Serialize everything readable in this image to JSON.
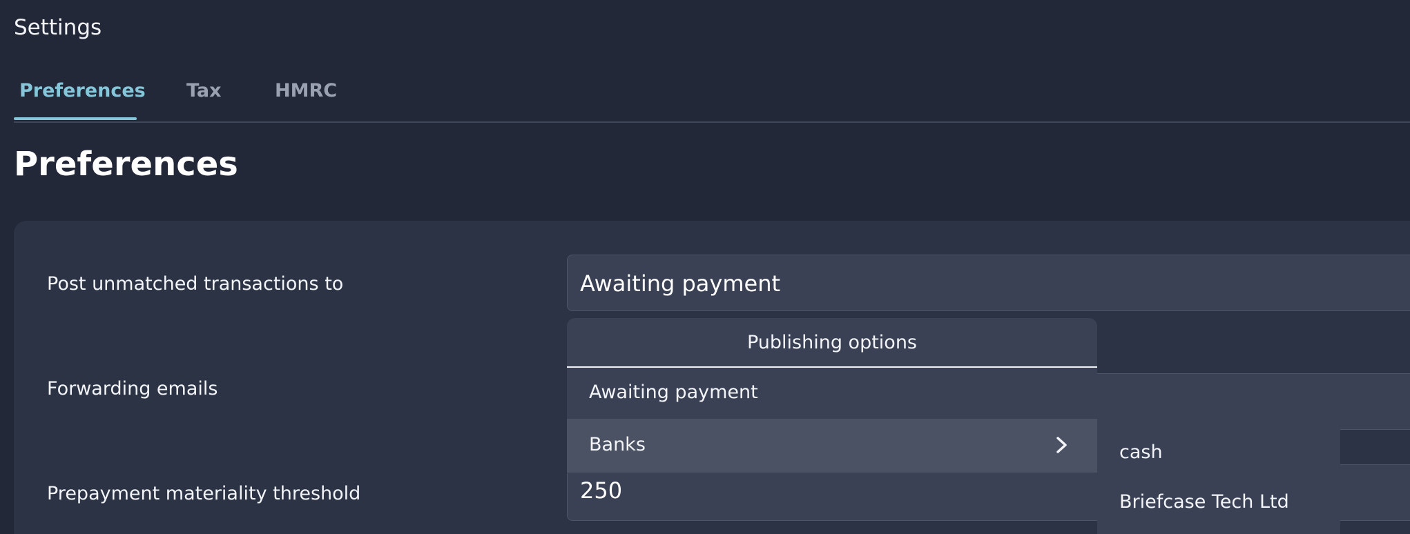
{
  "header": {
    "title": "Settings"
  },
  "tabs": [
    {
      "label": "Preferences",
      "active": true
    },
    {
      "label": "Tax",
      "active": false
    },
    {
      "label": "HMRC",
      "active": false
    }
  ],
  "section": {
    "title": "Preferences"
  },
  "rows": {
    "post_unmatched": {
      "label": "Post unmatched transactions to",
      "value": "Awaiting payment"
    },
    "forwarding": {
      "label": "Forwarding emails",
      "value": ""
    },
    "prepayment": {
      "label": "Prepayment materiality threshold",
      "value": "250"
    }
  },
  "dropdown": {
    "header": "Publishing options",
    "items": [
      {
        "label": "Awaiting payment",
        "has_submenu": false
      },
      {
        "label": "Banks",
        "has_submenu": true,
        "icon": "chevron-right-icon"
      }
    ]
  },
  "submenu": {
    "items": [
      {
        "label": "cash"
      },
      {
        "label": "Briefcase Tech Ltd"
      }
    ]
  },
  "colors": {
    "background": "#222838",
    "panel": "#2b3344",
    "field": "#3a4154",
    "accent": "#86c6da",
    "hover": "#4b5264"
  }
}
